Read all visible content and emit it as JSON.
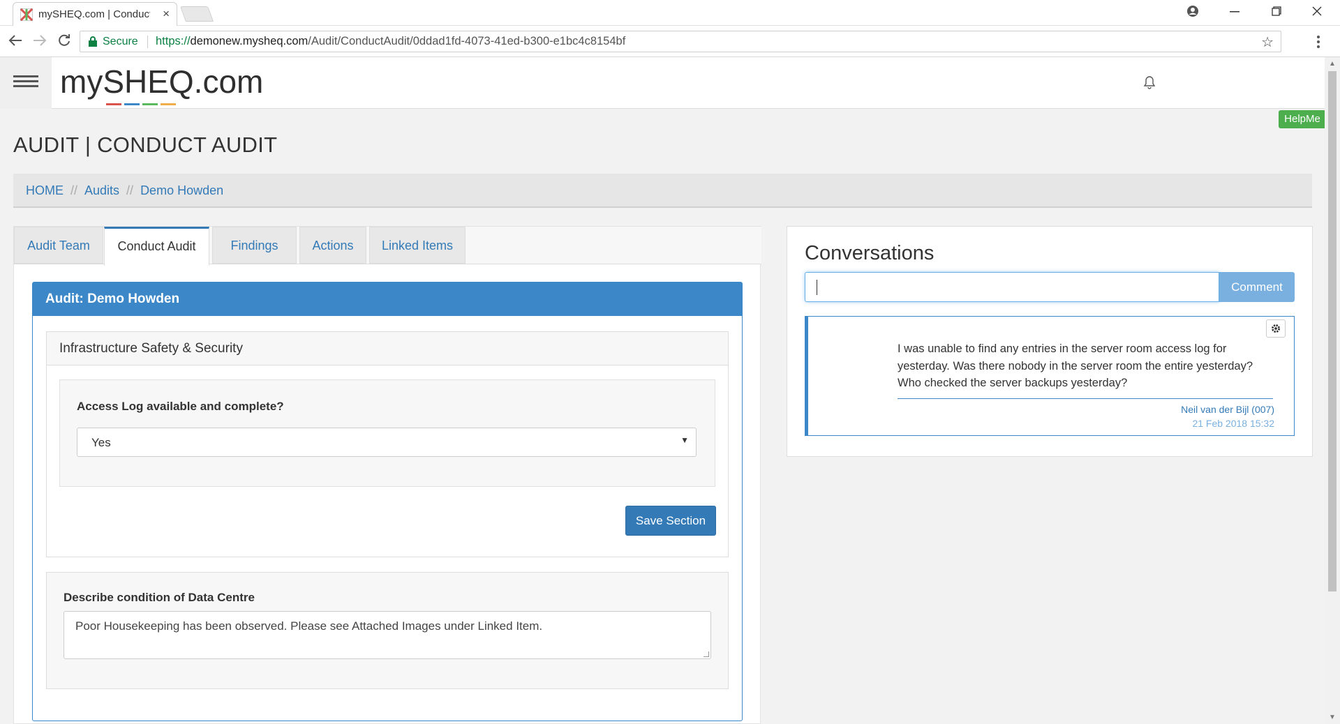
{
  "browser": {
    "tab_title": "mySHEQ.com | Conduct Audit",
    "tab_close": "×",
    "secure_label": "Secure",
    "url_scheme": "https://",
    "url_host": "demonew.mysheq.com",
    "url_path": "/Audit/ConductAudit/0ddad1fd-4073-41ed-b300-e1bc4c8154bf"
  },
  "header": {
    "logo_text": "mySHEQ.com",
    "helpme_label": "HelpMe"
  },
  "page": {
    "title": "AUDIT | CONDUCT AUDIT",
    "breadcrumb": [
      "HOME",
      "Audits",
      "Demo Howden"
    ],
    "breadcrumb_sep": "//"
  },
  "tabs": [
    "Audit Team",
    "Conduct Audit",
    "Findings",
    "Actions",
    "Linked Items"
  ],
  "audit": {
    "header": "Audit: Demo Howden",
    "section_title": "Infrastructure Safety & Security",
    "question1": "Access Log available and complete?",
    "answer1": "Yes",
    "save_label": "Save Section",
    "question2": "Describe condition of Data Centre",
    "answer2": "Poor Housekeeping has been observed. Please see Attached Images under Linked Item."
  },
  "conversations": {
    "title": "Conversations",
    "comment_button": "Comment",
    "comment_text": "I was unable to find any entries in the server room access log for yesterday. Was there nobody in the server room the entire yesterday? Who checked the server backups yesterday?",
    "author": "Neil van der Bijl (007)",
    "date": "21 Feb 2018 15:32"
  },
  "colors": {
    "primary": "#337ab7",
    "panel_header": "#3b87c8",
    "helpme": "#4cae4c",
    "secure": "#0b8043"
  },
  "icons": [
    "favicon-icon",
    "close-icon",
    "account-icon",
    "minimize-icon",
    "restore-icon",
    "window-close-icon",
    "back-icon",
    "forward-icon",
    "reload-icon",
    "lock-icon",
    "star-icon",
    "menu-dots-icon",
    "hamburger-icon",
    "bell-icon",
    "dropdown-arrow-icon",
    "gear-icon"
  ]
}
